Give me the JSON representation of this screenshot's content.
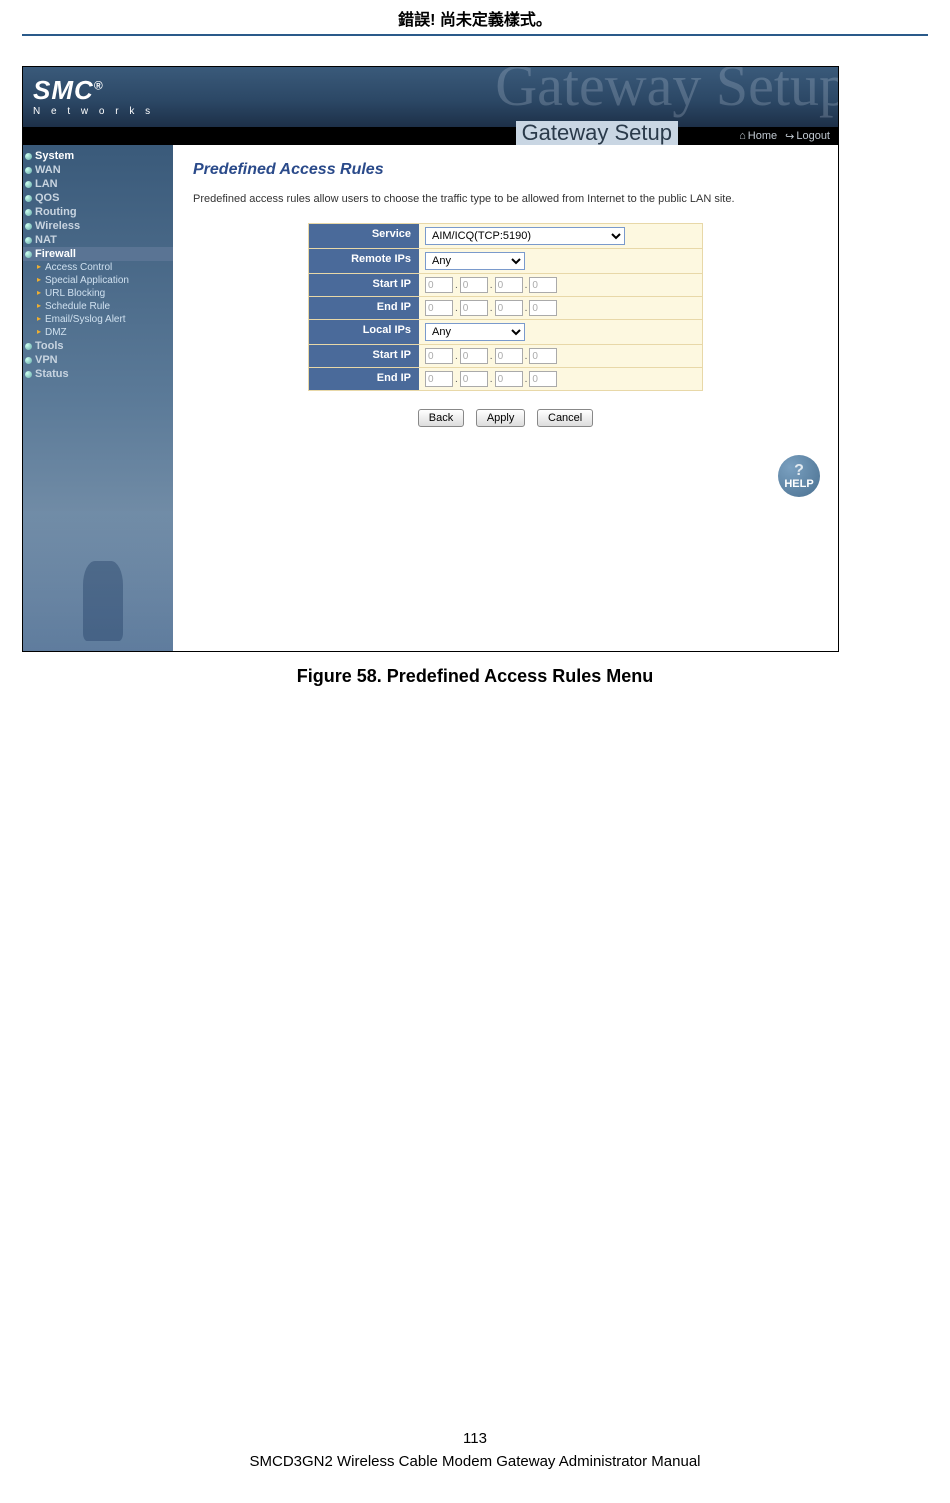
{
  "page": {
    "header_error": "錯誤! 尚未定義樣式。",
    "figure_caption": "Figure 58. Predefined Access Rules Menu",
    "page_number": "113",
    "footer_line": "SMCD3GN2 Wireless Cable Modem Gateway Administrator Manual"
  },
  "screenshot": {
    "brand": "SMC",
    "brand_suffix": "®",
    "brand_sub": "N e t w o r k s",
    "bg_title": "Gateway Setup",
    "gateway_label": "Gateway Setup",
    "topbar": {
      "home": "Home",
      "logout": "Logout"
    },
    "sidebar": {
      "items": [
        {
          "label": "System",
          "type": "top",
          "dim": false
        },
        {
          "label": "WAN",
          "type": "top",
          "dim": true
        },
        {
          "label": "LAN",
          "type": "top",
          "dim": true
        },
        {
          "label": "QOS",
          "type": "top",
          "dim": true
        },
        {
          "label": "Routing",
          "type": "top",
          "dim": true
        },
        {
          "label": "Wireless",
          "type": "top",
          "dim": true
        },
        {
          "label": "NAT",
          "type": "top",
          "dim": true
        },
        {
          "label": "Firewall",
          "type": "top",
          "active": true
        },
        {
          "label": "Access Control",
          "type": "sub"
        },
        {
          "label": "Special Application",
          "type": "sub"
        },
        {
          "label": "URL Blocking",
          "type": "sub"
        },
        {
          "label": "Schedule Rule",
          "type": "sub"
        },
        {
          "label": "Email/Syslog Alert",
          "type": "sub"
        },
        {
          "label": "DMZ",
          "type": "sub"
        },
        {
          "label": "Tools",
          "type": "top",
          "dim": true
        },
        {
          "label": "VPN",
          "type": "top",
          "dim": true
        },
        {
          "label": "Status",
          "type": "top",
          "dim": true
        }
      ]
    },
    "main": {
      "title": "Predefined Access Rules",
      "description": "Predefined access rules allow users to choose the traffic type to be allowed from Internet to the public LAN site.",
      "rows": [
        {
          "label": "Service",
          "field": "select_wide",
          "value": "AIM/ICQ(TCP:5190)"
        },
        {
          "label": "Remote IPs",
          "field": "select_mid",
          "value": "Any"
        },
        {
          "label": "Start IP",
          "field": "ip",
          "octets": [
            "0",
            "0",
            "0",
            "0"
          ]
        },
        {
          "label": "End IP",
          "field": "ip",
          "octets": [
            "0",
            "0",
            "0",
            "0"
          ]
        },
        {
          "label": "Local IPs",
          "field": "select_mid",
          "value": "Any"
        },
        {
          "label": "Start IP",
          "field": "ip",
          "octets": [
            "0",
            "0",
            "0",
            "0"
          ]
        },
        {
          "label": "End IP",
          "field": "ip",
          "octets": [
            "0",
            "0",
            "0",
            "0"
          ]
        }
      ],
      "buttons": {
        "back": "Back",
        "apply": "Apply",
        "cancel": "Cancel"
      },
      "help": "HELP"
    }
  }
}
